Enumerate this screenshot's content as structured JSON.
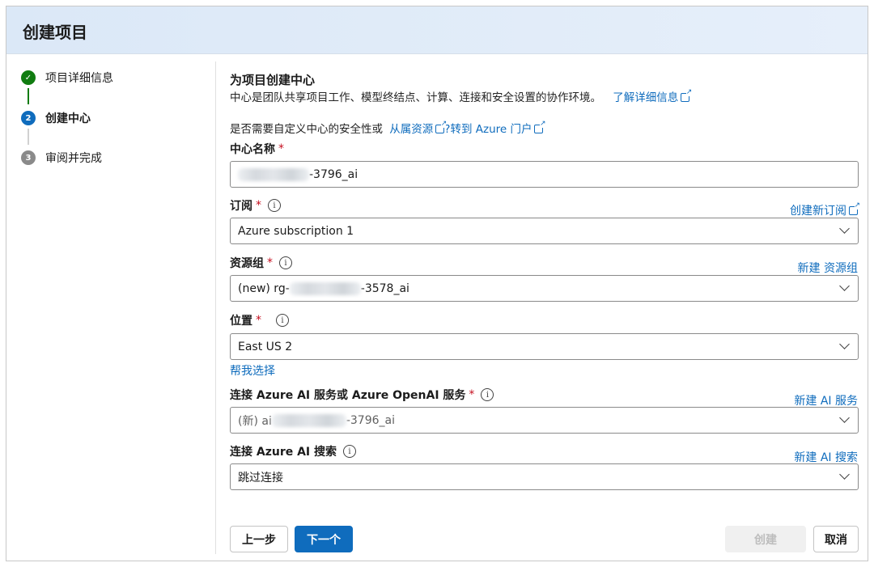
{
  "header": {
    "title": "创建项目"
  },
  "steps": [
    {
      "label": "项目详细信息",
      "state": "done",
      "marker": "✓"
    },
    {
      "label": "创建中心",
      "state": "current",
      "marker": "2"
    },
    {
      "label": "审阅并完成",
      "state": "pending",
      "marker": "3"
    }
  ],
  "section": {
    "title": "为项目创建中心",
    "description": "中心是团队共享项目工作、模型终结点、计算、连接和安全设置的协作环境。",
    "learn_more": "了解详细信息",
    "security_prefix": "是否需要自定义中心的安全性或",
    "security_link1": "从属资源",
    "security_link2": "?转到 Azure 门户"
  },
  "fields": {
    "hub_name": {
      "label": "中心名称",
      "value_suffix": "-3796_ai"
    },
    "subscription": {
      "label": "订阅",
      "value": "Azure subscription 1",
      "link": "创建新订阅"
    },
    "resource_group": {
      "label": "资源组",
      "value_prefix": "(new) rg-",
      "value_suffix": "-3578_ai",
      "link": "新建 资源组"
    },
    "location": {
      "label": "位置",
      "value": "East US 2",
      "help_link": "帮我选择"
    },
    "ai_service": {
      "label": "连接 Azure AI 服务或 Azure OpenAI 服务",
      "value_prefix": "(新) ai",
      "value_suffix": "-3796_ai",
      "link": "新建 AI 服务"
    },
    "ai_search": {
      "label": "连接 Azure AI 搜索",
      "value": "跳过连接",
      "link": "新建 AI 搜索"
    }
  },
  "buttons": {
    "prev": "上一步",
    "next": "下一个",
    "create": "创建",
    "cancel": "取消"
  },
  "colors": {
    "accent": "#0f6cbd",
    "success": "#107c10",
    "required": "#c50f1f"
  }
}
